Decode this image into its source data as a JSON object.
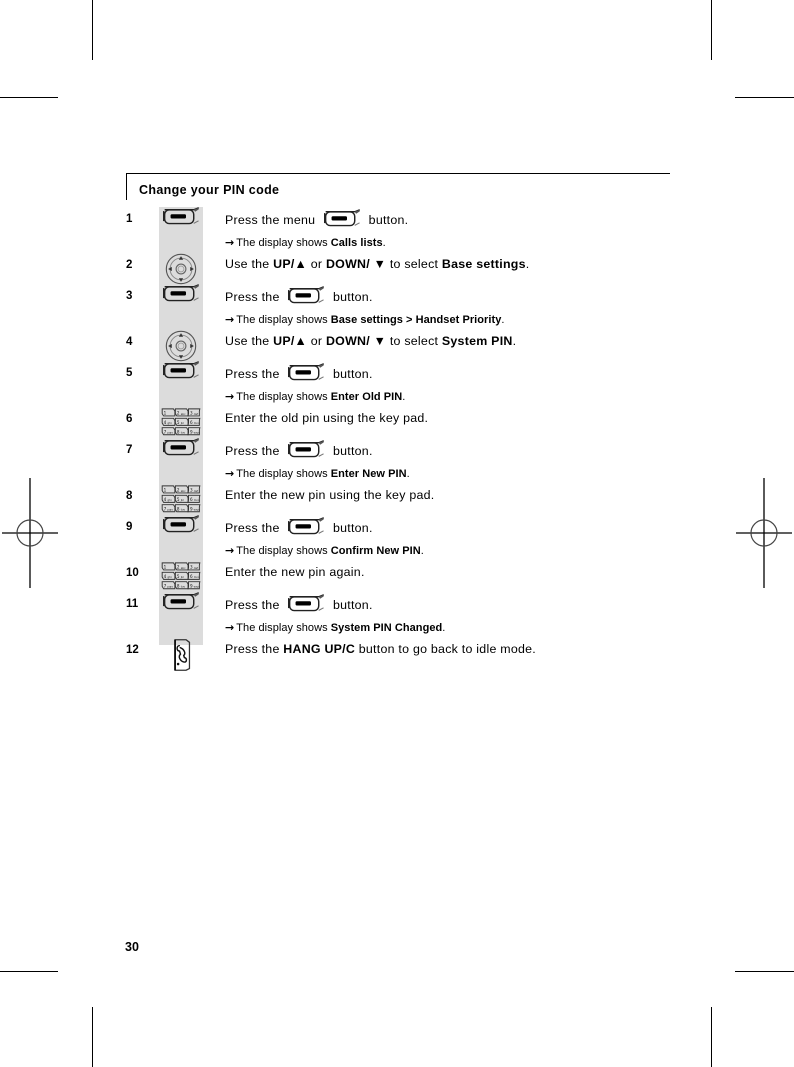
{
  "page": {
    "number": "30",
    "section_title": "Change your PIN code"
  },
  "icons": {
    "menu_button": "menu-softkey-icon",
    "navigation_pad": "navigation-dpad-icon",
    "keypad": "numeric-keypad-icon",
    "hangup_button": "hang-up-button-icon",
    "arrow": "→"
  },
  "steps": [
    {
      "number": "1",
      "icon": "menu-softkey-icon",
      "main_pre": "Press the menu ",
      "main_post": " button.",
      "has_inline_icon": true,
      "sub_pre": "The display shows ",
      "sub_bold": "Calls lists",
      "sub_post": "."
    },
    {
      "number": "2",
      "icon": "navigation-dpad-icon",
      "main_full": "Use the UP/▲ or DOWN/ ▼ to select Base settings.",
      "main_segments": [
        {
          "text": "Use the ",
          "bold": false
        },
        {
          "text": "UP/▲",
          "bold": true
        },
        {
          "text": " or ",
          "bold": false
        },
        {
          "text": "DOWN/ ▼",
          "bold": true
        },
        {
          "text": " to select ",
          "bold": false
        },
        {
          "text": "Base settings",
          "bold": true
        },
        {
          "text": ".",
          "bold": false
        }
      ]
    },
    {
      "number": "3",
      "icon": "menu-softkey-icon",
      "main_pre": "Press the ",
      "main_post": " button.",
      "has_inline_icon": true,
      "sub_pre": "The display shows ",
      "sub_bold": "Base settings > Handset Priority",
      "sub_post": "."
    },
    {
      "number": "4",
      "icon": "navigation-dpad-icon",
      "main_full": "Use the UP/▲ or DOWN/ ▼ to select System PIN.",
      "main_segments": [
        {
          "text": "Use the ",
          "bold": false
        },
        {
          "text": "UP/▲",
          "bold": true
        },
        {
          "text": " or ",
          "bold": false
        },
        {
          "text": "DOWN/ ▼",
          "bold": true
        },
        {
          "text": " to select ",
          "bold": false
        },
        {
          "text": "System PIN",
          "bold": true
        },
        {
          "text": ".",
          "bold": false
        }
      ]
    },
    {
      "number": "5",
      "icon": "menu-softkey-icon",
      "main_pre": "Press the ",
      "main_post": " button.",
      "has_inline_icon": true,
      "sub_pre": "The display shows ",
      "sub_bold": "Enter Old PIN",
      "sub_post": "."
    },
    {
      "number": "6",
      "icon": "numeric-keypad-icon",
      "main_full": "Enter the old pin using the key pad.",
      "main_segments": [
        {
          "text": "Enter the old pin using the key pad.",
          "bold": false
        }
      ]
    },
    {
      "number": "7",
      "icon": "menu-softkey-icon",
      "main_pre": "Press the ",
      "main_post": " button.",
      "has_inline_icon": true,
      "sub_pre": "The display shows ",
      "sub_bold": "Enter New PIN",
      "sub_post": "."
    },
    {
      "number": "8",
      "icon": "numeric-keypad-icon",
      "main_full": "Enter the new pin using the key pad.",
      "main_segments": [
        {
          "text": "Enter the new pin using the key pad.",
          "bold": false
        }
      ]
    },
    {
      "number": "9",
      "icon": "menu-softkey-icon",
      "main_pre": "Press the ",
      "main_post": " button.",
      "has_inline_icon": true,
      "sub_pre": "The display shows ",
      "sub_bold": "Confirm New PIN",
      "sub_post": "."
    },
    {
      "number": "10",
      "icon": "numeric-keypad-icon",
      "main_full": "Enter the new pin again.",
      "main_segments": [
        {
          "text": "Enter the new pin again.",
          "bold": false
        }
      ]
    },
    {
      "number": "11",
      "icon": "menu-softkey-icon",
      "main_pre": "Press the ",
      "main_post": " button.",
      "has_inline_icon": true,
      "sub_pre": "The display shows ",
      "sub_bold": "System PIN Changed",
      "sub_post": "."
    },
    {
      "number": "12",
      "icon": "hang-up-button-icon",
      "main_full": "Press the HANG UP/C button to go back to idle mode.",
      "main_segments": [
        {
          "text": "Press the ",
          "bold": false
        },
        {
          "text": "HANG UP/C",
          "bold": true
        },
        {
          "text": " button to go back to idle mode.",
          "bold": false
        }
      ]
    }
  ],
  "keypad_keys": [
    {
      "digit": "1",
      "letters": ""
    },
    {
      "digit": "2",
      "letters": "abc"
    },
    {
      "digit": "3",
      "letters": "def"
    },
    {
      "digit": "4",
      "letters": "ghi"
    },
    {
      "digit": "5",
      "letters": "jkl"
    },
    {
      "digit": "6",
      "letters": "mno"
    },
    {
      "digit": "7",
      "letters": "pqrs"
    },
    {
      "digit": "8",
      "letters": "tuv"
    },
    {
      "digit": "9",
      "letters": "wxyz"
    }
  ],
  "colors": {
    "icon_strip_bg": "#dcdcdc",
    "text": "#000000",
    "page_bg": "#ffffff"
  }
}
